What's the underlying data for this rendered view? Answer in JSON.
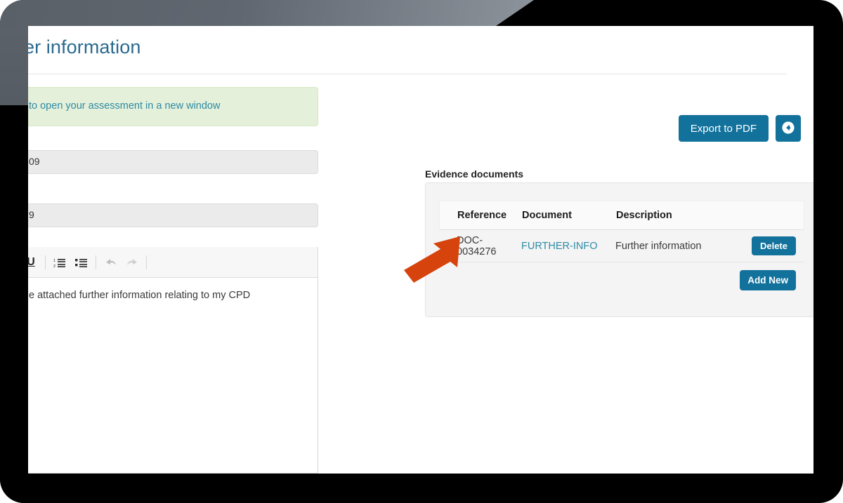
{
  "page": {
    "title": "er information"
  },
  "alert": {
    "text": "to open your assessment in a new window"
  },
  "form": {
    "fields": [
      {
        "name": "field-1",
        "value": "09"
      },
      {
        "name": "field-2",
        "value": "9"
      }
    ]
  },
  "editor": {
    "toolbar": [
      {
        "name": "underline-icon",
        "label": "U"
      },
      {
        "name": "ordered-list-icon",
        "label": ""
      },
      {
        "name": "unordered-list-icon",
        "label": ""
      },
      {
        "name": "undo-icon",
        "label": ""
      },
      {
        "name": "redo-icon",
        "label": ""
      }
    ],
    "content": "e attached further information relating to my CPD"
  },
  "actions": {
    "export_label": "Export to PDF",
    "back_icon": "arrow-circle-left-icon"
  },
  "evidence": {
    "section_label": "Evidence documents",
    "columns": [
      "Reference",
      "Document",
      "Description"
    ],
    "rows": [
      {
        "reference": "DOC-0034276",
        "document": "FURTHER-INFO",
        "description": "Further information",
        "delete_label": "Delete"
      }
    ],
    "add_new_label": "Add New"
  },
  "annotation": {
    "arrow_color": "#d6430d",
    "direction": "up-right"
  },
  "colors": {
    "accent": "#12729c",
    "title": "#2b6a8e",
    "link": "#2e8ba6",
    "alert_bg": "#e4f0d9",
    "panel_bg": "#f4f4f4",
    "frame": "#000000",
    "banner": "#5a6067"
  }
}
